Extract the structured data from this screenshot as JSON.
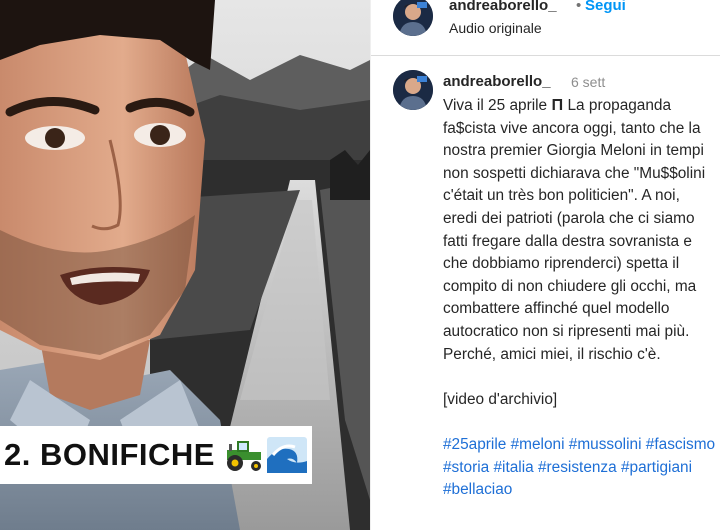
{
  "video": {
    "caption": "2. BONIFICHE",
    "caption_emoji": [
      "tractor-emoji",
      "wave-emoji"
    ]
  },
  "post_header": {
    "username": "andreaborello_",
    "separator": "•",
    "follow_label": "Segui",
    "audio_label": "Audio originale"
  },
  "comment": {
    "username": "andreaborello_",
    "time": "6 sett",
    "lines": [
      "Viva il 25 aprile 𝚷 La propaganda",
      "fa$cista vive ancora oggi, tanto che la",
      "nostra premier Giorgia Meloni in tempi",
      "non sospetti dichiarava che \"Mu$$olini",
      "c'était un très bon politicien\". A noi,",
      "eredi dei patrioti (parola che ci siamo",
      "fatti fregare dalla destra sovranista e",
      "che dobbiamo riprenderci) spetta il",
      "compito di non chiudere gli occhi, ma",
      "combattere affinché quel modello",
      "autocratico non si ripresenti mai più.",
      "Perché, amici miei, il rischio c'è."
    ],
    "note": "[video d'archivio]",
    "hashtag_lines": [
      [
        "#25aprile",
        "#meloni",
        "#mussolini",
        "#fascismo"
      ],
      [
        "#storia",
        "#italia",
        "#resistenza",
        "#partigiani"
      ],
      [
        "#bellaciao"
      ]
    ]
  },
  "colors": {
    "link_blue": "#0095f6",
    "hashtag_blue": "#1e6fd6",
    "muted_gray": "#8e8e8e",
    "text": "#262626"
  }
}
